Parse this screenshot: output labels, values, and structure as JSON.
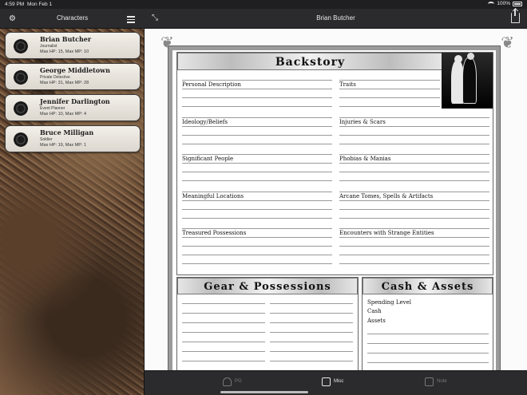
{
  "status_bar": {
    "time": "4:59 PM",
    "date": "Mon Feb 1",
    "battery": "100%"
  },
  "sidebar": {
    "title": "Characters",
    "characters": [
      {
        "name": "Brian Butcher",
        "occupation": "Journalist",
        "stats": "Max HP: 15, Max MP: 10"
      },
      {
        "name": "George Middletown",
        "occupation": "Private Detective",
        "stats": "Max HP: 31, Max MP: 28"
      },
      {
        "name": "Jennifer Darlington",
        "occupation": "Event Planner",
        "stats": "Max HP: 10, Max MP: 4"
      },
      {
        "name": "Bruce Milligan",
        "occupation": "Soldier",
        "stats": "Max HP: 19, Max MP: 1"
      }
    ]
  },
  "header": {
    "title": "Brian Butcher"
  },
  "backstory": {
    "title": "Backstory",
    "fields": [
      "Personal Description",
      "Traits",
      "Ideology/Beliefs",
      "Injuries & Scars",
      "Significant People",
      "Phobias & Manias",
      "Meaningful Locations",
      "Arcane Tomes, Spells & Artifacts",
      "Treasured Possessions",
      "Encounters with Strange Entities"
    ]
  },
  "gear": {
    "title": "Gear & Possessions"
  },
  "cash": {
    "title": "Cash & Assets",
    "fields": [
      "Spending Level",
      "Cash",
      "Assets"
    ]
  },
  "tabs": [
    {
      "label": "PG",
      "active": false
    },
    {
      "label": "Misc",
      "active": true
    },
    {
      "label": "Note",
      "active": false
    }
  ]
}
